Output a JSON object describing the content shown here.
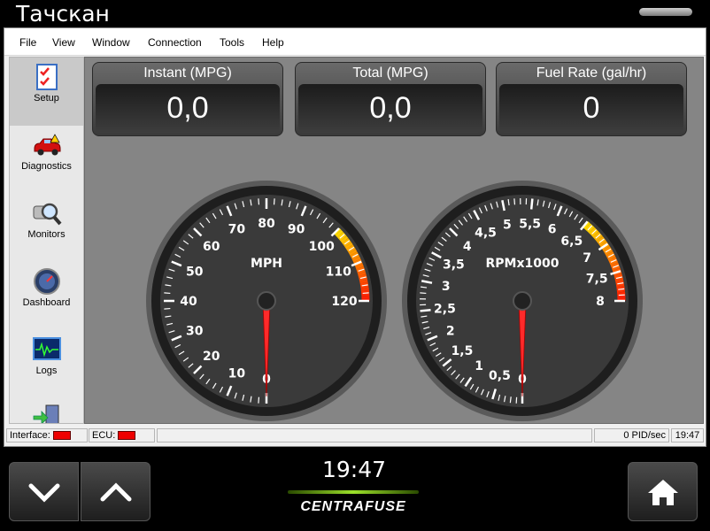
{
  "app": {
    "title": "Тачскан"
  },
  "menu": [
    "File",
    "View",
    "Window",
    "Connection",
    "Tools",
    "Help"
  ],
  "sidebar": {
    "items": [
      {
        "label": "Setup",
        "icon": "checklist-icon",
        "active": true
      },
      {
        "label": "Diagnostics",
        "icon": "red-car-icon",
        "active": false
      },
      {
        "label": "Monitors",
        "icon": "magnifier-icon",
        "active": false
      },
      {
        "label": "Dashboard",
        "icon": "gauge-icon",
        "active": false
      },
      {
        "label": "Logs",
        "icon": "waveform-icon",
        "active": false
      },
      {
        "label": "",
        "icon": "exit-door-icon",
        "active": false
      }
    ]
  },
  "readouts": [
    {
      "label": "Instant (MPG)",
      "value": "0,0"
    },
    {
      "label": "Total (MPG)",
      "value": "0,0"
    },
    {
      "label": "Fuel Rate (gal/hr)",
      "value": "0"
    }
  ],
  "gauges": {
    "speed": {
      "unit_label": "MPH",
      "ticks": [
        "0",
        "10",
        "20",
        "30",
        "40",
        "50",
        "60",
        "70",
        "80",
        "90",
        "100",
        "110",
        "120"
      ],
      "value": 0,
      "max": 120,
      "redline_from": 100
    },
    "rpm": {
      "unit_label": "RPMx1000",
      "ticks": [
        "0",
        "0,5",
        "1",
        "1,5",
        "2",
        "2,5",
        "3",
        "3,5",
        "4",
        "4,5",
        "5",
        "5,5",
        "6",
        "6,5",
        "7",
        "7,5",
        "8"
      ],
      "value": 0,
      "max": 8,
      "redline_from": 6.5
    }
  },
  "status": {
    "interface_label": "Interface:",
    "ecu_label": "ECU:",
    "pid_rate": "0 PID/sec",
    "time": "19:47"
  },
  "bottom": {
    "clock": "19:47",
    "brand": "CENTRAFUSE"
  },
  "colors": {
    "indicator_red": "#e00000",
    "accent_green": "#9be02a",
    "needle_red": "#ff2a2a"
  }
}
